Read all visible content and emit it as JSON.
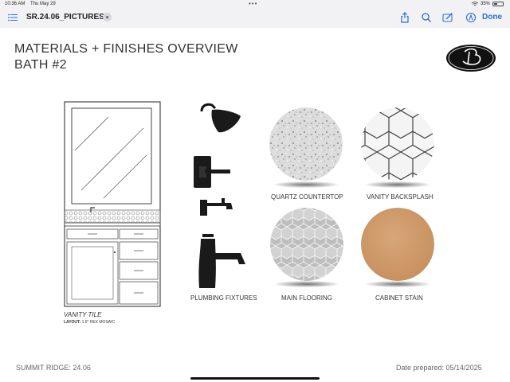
{
  "status_bar": {
    "time": "10:36 AM",
    "date": "Thu May 29",
    "battery": "35%",
    "battery_level": 0.35
  },
  "toolbar": {
    "title": "SR.24.06_PICTURES",
    "done_label": "Done",
    "icons": [
      "list-icon",
      "chevron-down-icon",
      "share-icon",
      "search-icon",
      "markup-icon",
      "pen-icon"
    ]
  },
  "document": {
    "title_line1": "MATERIALS + FINISHES OVERVIEW",
    "title_line2": "BATH #2",
    "vanity": {
      "label": "VANITY TILE",
      "layout_label": "LAYOUT:",
      "layout_value": "1.5\" HEX MOSAIC"
    },
    "fixtures_label": "PLUMBING FIXTURES",
    "swatches": [
      {
        "label": "QUARTZ COUNTERTOP"
      },
      {
        "label": "VANITY BACKSPLASH"
      },
      {
        "label": "MAIN FLOORING"
      },
      {
        "label": "CABINET STAIN"
      }
    ],
    "footer_left": "SUMMIT RIDGE: 24.06",
    "footer_right": "Date prepared: 05/14/2025"
  }
}
